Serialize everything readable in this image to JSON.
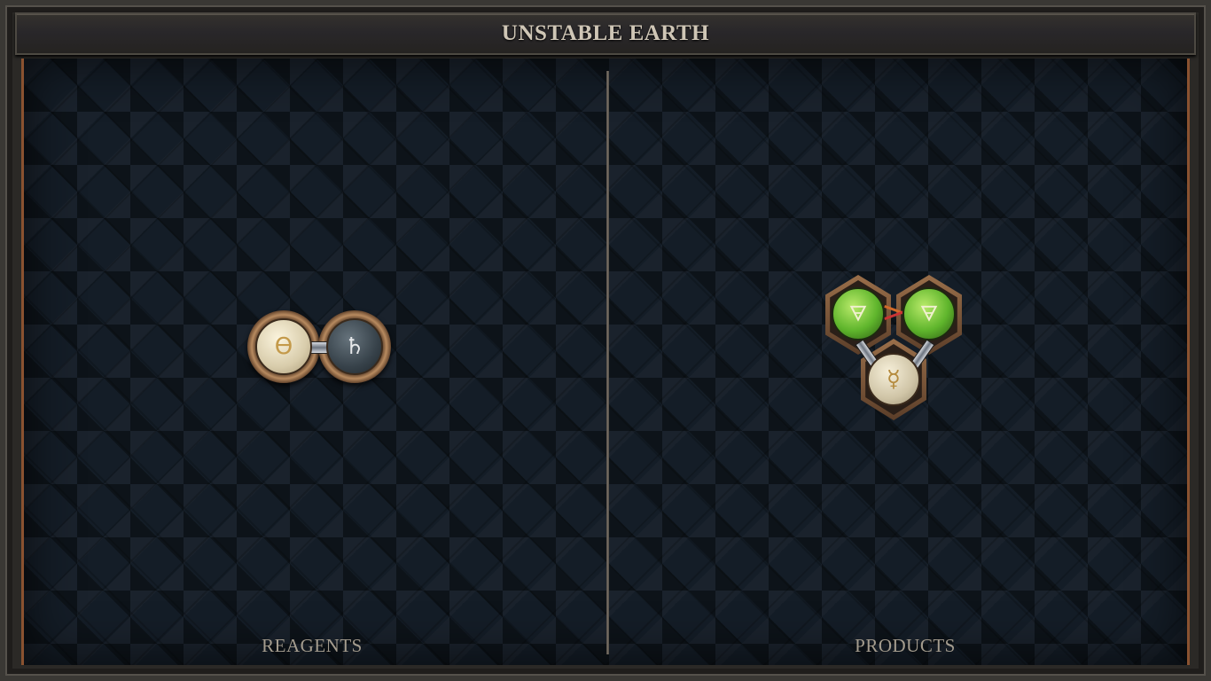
{
  "header": {
    "title": "UNSTABLE EARTH"
  },
  "reagents": {
    "label": "REAGENTS",
    "atoms": [
      {
        "element": "salt",
        "glyph": "ϴ",
        "color": "#e9dfc3"
      },
      {
        "element": "lead",
        "glyph": "♄",
        "color": "#3f4a52"
      }
    ],
    "bond": "single"
  },
  "products": {
    "label": "PRODUCTS",
    "atoms": [
      {
        "element": "earth",
        "glyph": "🜃",
        "color": "#5fb52c"
      },
      {
        "element": "earth",
        "glyph": "🜃",
        "color": "#5fb52c"
      },
      {
        "element": "quicksilver",
        "glyph": "☿",
        "color": "#e2d9c2"
      }
    ],
    "bonds": [
      "triplex",
      "single",
      "single"
    ]
  },
  "colors": {
    "accent_copper": "#8a5230",
    "board_bg": "#141d27",
    "label_text": "#a49c8e"
  }
}
